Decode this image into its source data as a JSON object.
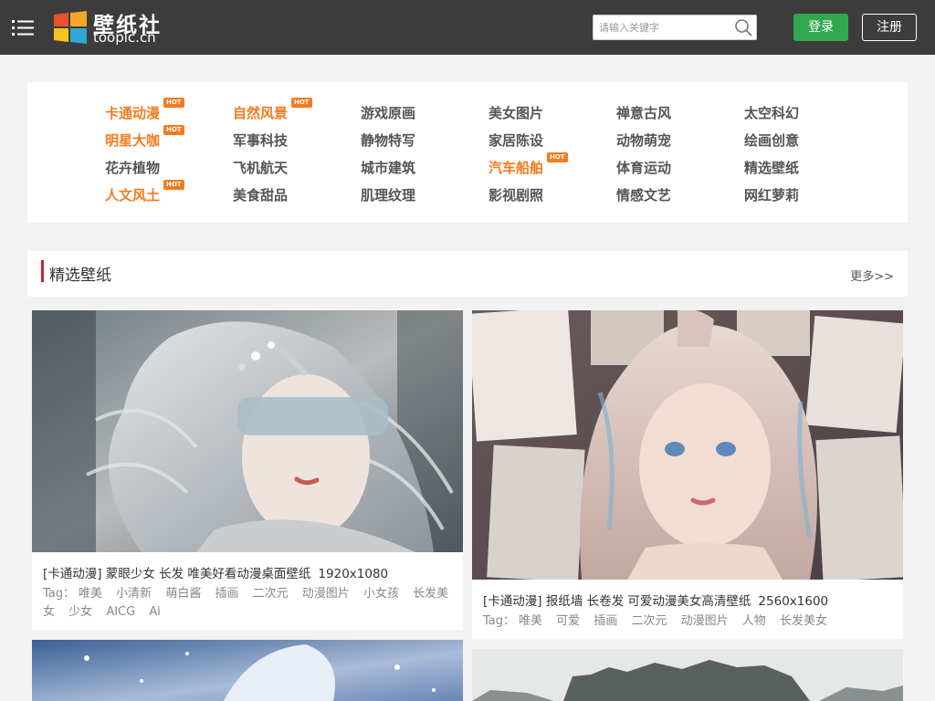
{
  "header": {
    "logo_cn": "壁纸社",
    "logo_en": "toopic.cn",
    "search_placeholder": "请输入关键字",
    "login_label": "登录",
    "register_label": "注册"
  },
  "categories": [
    {
      "label": "卡通动漫",
      "hot": true
    },
    {
      "label": "自然风景",
      "hot": true
    },
    {
      "label": "游戏原画",
      "hot": false
    },
    {
      "label": "美女图片",
      "hot": false
    },
    {
      "label": "禅意古风",
      "hot": false
    },
    {
      "label": "太空科幻",
      "hot": false
    },
    {
      "label": "明星大咖",
      "hot": true
    },
    {
      "label": "军事科技",
      "hot": false
    },
    {
      "label": "静物特写",
      "hot": false
    },
    {
      "label": "家居陈设",
      "hot": false
    },
    {
      "label": "动物萌宠",
      "hot": false
    },
    {
      "label": "绘画创意",
      "hot": false
    },
    {
      "label": "花卉植物",
      "hot": false
    },
    {
      "label": "飞机航天",
      "hot": false
    },
    {
      "label": "城市建筑",
      "hot": false
    },
    {
      "label": "汽车船舶",
      "hot": true
    },
    {
      "label": "体育运动",
      "hot": false
    },
    {
      "label": "精选壁纸",
      "hot": false
    },
    {
      "label": "人文风土",
      "hot": true
    },
    {
      "label": "美食甜品",
      "hot": false
    },
    {
      "label": "肌理纹理",
      "hot": false
    },
    {
      "label": "影视剧照",
      "hot": false
    },
    {
      "label": "情感文艺",
      "hot": false
    },
    {
      "label": "网红萝莉",
      "hot": false
    }
  ],
  "hot_badge_text": "HOT",
  "section": {
    "title": "精选壁纸",
    "more_label": "更多>>"
  },
  "tag_label": "Tag：",
  "cards": [
    {
      "title": "[卡通动漫] 蒙眼少女 长发 唯美好看动漫桌面壁纸",
      "resolution": "1920x1080",
      "tags": [
        "唯美",
        "小清新",
        "萌白酱",
        "插画",
        "二次元",
        "动漫图片",
        "小女孩",
        "长发美女",
        "少女",
        "AICG",
        "Ai"
      ]
    },
    {
      "title": "[卡通动漫] 报纸墙 长卷发 可爱动漫美女高清壁纸",
      "resolution": "2560x1600",
      "tags": [
        "唯美",
        "可爱",
        "插画",
        "二次元",
        "动漫图片",
        "人物",
        "长发美女"
      ]
    }
  ],
  "colors": {
    "header_bg": "#3c3c3c",
    "accent_orange": "#f57a1e",
    "login_green": "#2fa84f",
    "section_red": "#d0202a"
  },
  "icons": {
    "menu": "list-menu-icon",
    "search": "magnifier-icon"
  }
}
